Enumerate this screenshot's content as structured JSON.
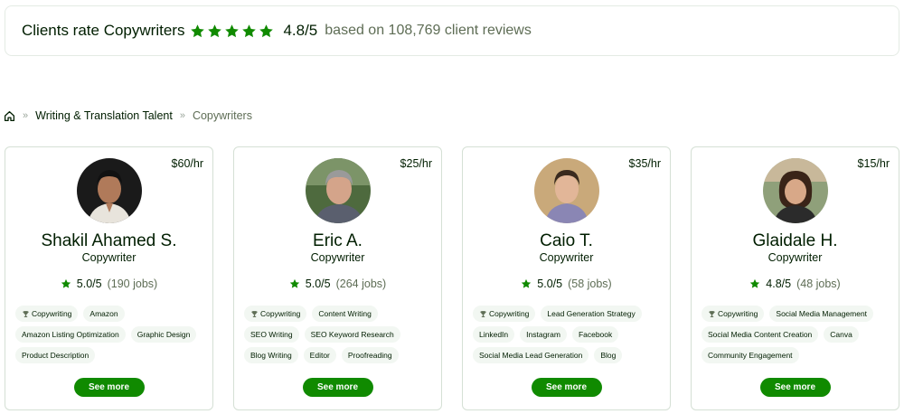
{
  "banner": {
    "title": "Clients rate Copywriters",
    "stars": 5,
    "score": "4.8/5",
    "reviews": "based on 108,769 client reviews",
    "star_color": "#108a00"
  },
  "breadcrumb": {
    "home_icon": "home-icon",
    "separator": "»",
    "items": [
      "Writing & Translation Talent",
      "Copywriters"
    ]
  },
  "cards": [
    {
      "name": "Shakil Ahamed S.",
      "role": "Copywriter",
      "rate": "$60/hr",
      "score": "5.0/5",
      "jobs": "(190 jobs)",
      "skills": [
        "Copywriting",
        "Amazon",
        "Amazon Listing Optimization",
        "Graphic Design",
        "Product Description"
      ],
      "button": "See more"
    },
    {
      "name": "Eric A.",
      "role": "Copywriter",
      "rate": "$25/hr",
      "score": "5.0/5",
      "jobs": "(264 jobs)",
      "skills": [
        "Copywriting",
        "Content Writing",
        "SEO Writing",
        "SEO Keyword Research",
        "Blog Writing",
        "Editor",
        "Proofreading"
      ],
      "button": "See more"
    },
    {
      "name": "Caio T.",
      "role": "Copywriter",
      "rate": "$35/hr",
      "score": "5.0/5",
      "jobs": "(58 jobs)",
      "skills": [
        "Copywriting",
        "Lead Generation Strategy",
        "LinkedIn",
        "Instagram",
        "Facebook",
        "Social Media Lead Generation",
        "Blog"
      ],
      "button": "See more"
    },
    {
      "name": "Glaidale H.",
      "role": "Copywriter",
      "rate": "$15/hr",
      "score": "4.8/5",
      "jobs": "(48 jobs)",
      "skills": [
        "Copywriting",
        "Social Media Management",
        "Social Media Content Creation",
        "Canva",
        "Community Engagement"
      ],
      "button": "See more"
    }
  ],
  "accent_color": "#108a00"
}
